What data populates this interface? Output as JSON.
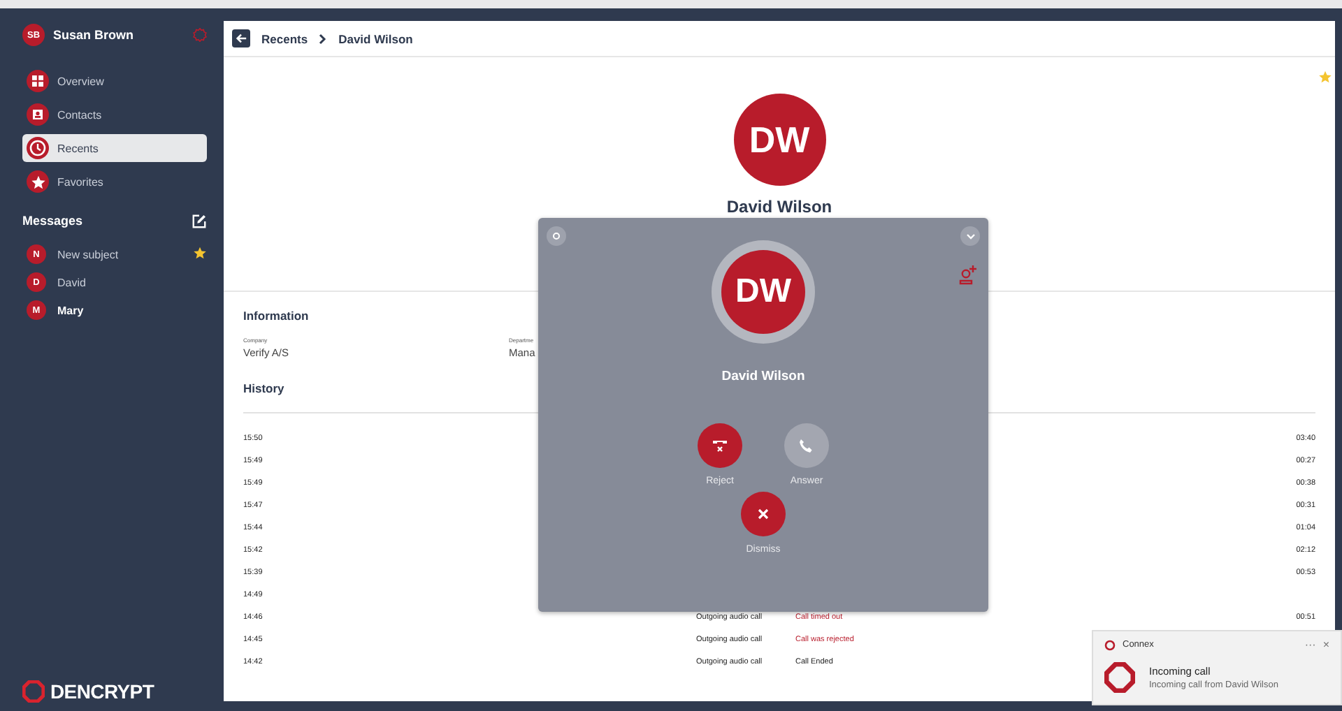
{
  "sidebar": {
    "user": {
      "initials": "SB",
      "name": "Susan Brown"
    },
    "nav": [
      {
        "label": "Overview",
        "selected": false
      },
      {
        "label": "Contacts",
        "selected": false
      },
      {
        "label": "Recents",
        "selected": true
      },
      {
        "label": "Favorites",
        "selected": false
      }
    ],
    "messages_title": "Messages",
    "messages": [
      {
        "initial": "N",
        "name": "New subject",
        "starred": true,
        "unread": false
      },
      {
        "initial": "D",
        "name": "David",
        "starred": false,
        "unread": false
      },
      {
        "initial": "M",
        "name": "Mary",
        "starred": false,
        "unread": true
      }
    ],
    "logo": "DENCRYPT"
  },
  "breadcrumb": [
    "Recents",
    "David Wilson"
  ],
  "contact": {
    "initials": "DW",
    "name": "David Wilson",
    "favorite": true
  },
  "information": {
    "title": "Information",
    "fields": [
      {
        "label": "Company",
        "value": "Verify A/S"
      },
      {
        "label": "Departme",
        "value": "Mana"
      }
    ]
  },
  "history": {
    "title": "History",
    "rows": [
      {
        "time": "15:50",
        "duration": "03:40"
      },
      {
        "time": "15:49",
        "duration": "00:27"
      },
      {
        "time": "15:49",
        "duration": "00:38"
      },
      {
        "time": "15:47",
        "duration": "00:31"
      },
      {
        "time": "15:44",
        "duration": "01:04"
      },
      {
        "time": "15:42",
        "duration": "02:12"
      },
      {
        "time": "15:39",
        "duration": "00:53"
      },
      {
        "time": "14:49"
      },
      {
        "time": "14:46",
        "type": "Outgoing audio call",
        "status": "Call timed out",
        "kind": "failed",
        "duration": "00:51"
      },
      {
        "time": "14:45",
        "type": "Outgoing audio call",
        "status": "Call was rejected",
        "kind": "failed"
      },
      {
        "time": "14:42",
        "type": "Outgoing audio call",
        "status": "Call Ended",
        "kind": "ok"
      }
    ]
  },
  "call_dialog": {
    "initials": "DW",
    "name": "David Wilson",
    "actions": [
      {
        "label": "Reject",
        "kind": "reject"
      },
      {
        "label": "Answer",
        "kind": "answer"
      },
      {
        "label": "Dismiss",
        "kind": "dismiss"
      }
    ]
  },
  "notification": {
    "app": "Connex",
    "more": "···",
    "close": "×",
    "title": "Incoming call",
    "body": "Incoming call from David Wilson"
  }
}
